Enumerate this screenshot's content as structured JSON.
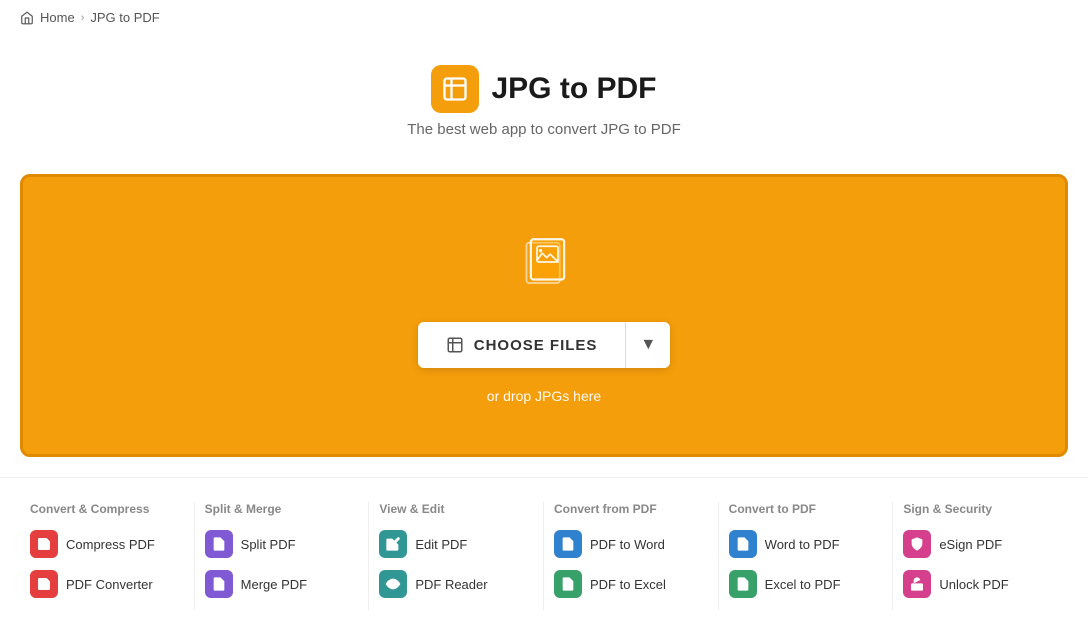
{
  "breadcrumb": {
    "home": "Home",
    "current": "JPG to PDF"
  },
  "hero": {
    "title": "JPG to PDF",
    "subtitle": "The best web app to convert JPG to PDF",
    "choose_files_label": "CHOOSE FILES",
    "drop_text": "or drop JPGs here",
    "accent_color": "#f59e0b"
  },
  "tools": {
    "columns": [
      {
        "title": "Convert & Compress",
        "items": [
          {
            "label": "Compress PDF",
            "icon_color": "icon-red"
          },
          {
            "label": "PDF Converter",
            "icon_color": "icon-red"
          }
        ]
      },
      {
        "title": "Split & Merge",
        "items": [
          {
            "label": "Split PDF",
            "icon_color": "icon-purple"
          },
          {
            "label": "Merge PDF",
            "icon_color": "icon-purple"
          }
        ]
      },
      {
        "title": "View & Edit",
        "items": [
          {
            "label": "Edit PDF",
            "icon_color": "icon-teal"
          },
          {
            "label": "PDF Reader",
            "icon_color": "icon-teal"
          }
        ]
      },
      {
        "title": "Convert from PDF",
        "items": [
          {
            "label": "PDF to Word",
            "icon_color": "icon-blue"
          },
          {
            "label": "PDF to Excel",
            "icon_color": "icon-green"
          }
        ]
      },
      {
        "title": "Convert to PDF",
        "items": [
          {
            "label": "Word to PDF",
            "icon_color": "icon-blue"
          },
          {
            "label": "Excel to PDF",
            "icon_color": "icon-green"
          }
        ]
      },
      {
        "title": "Sign & Security",
        "items": [
          {
            "label": "eSign PDF",
            "icon_color": "icon-pink"
          },
          {
            "label": "Unlock PDF",
            "icon_color": "icon-pink"
          }
        ]
      }
    ]
  }
}
